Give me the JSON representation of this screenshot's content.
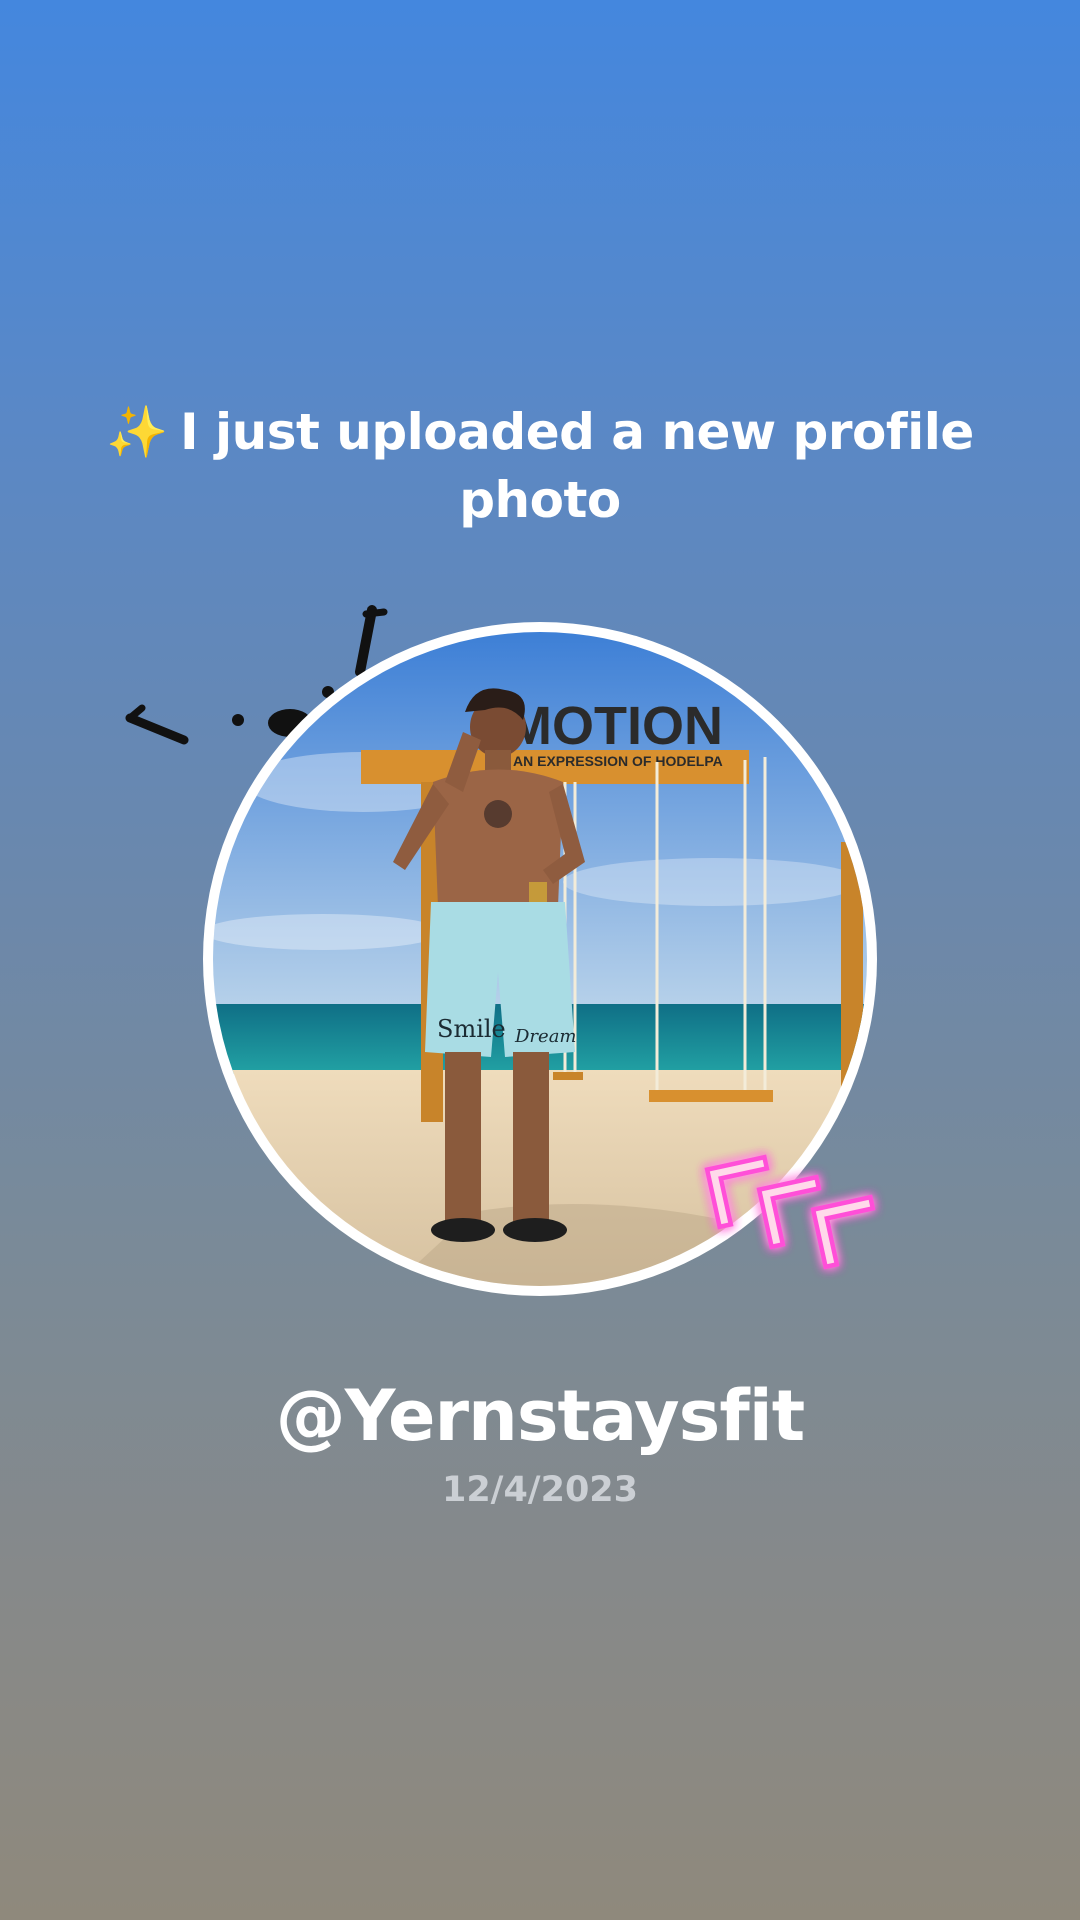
{
  "headline": {
    "sparkle_icon": "✨",
    "text": "I just uploaded a new profile photo"
  },
  "profile": {
    "username": "@Yernstaysfit",
    "date": "12/4/2023"
  },
  "photo": {
    "sign_text": "EMOTION",
    "sign_subtext": "AN EXPRESSION OF HODELPA",
    "shorts_text_1": "Smile",
    "shorts_text_2": "Dream"
  },
  "decorations": {
    "doodle": "face-doodle-icon",
    "neon": "neon-chevrons-icon"
  },
  "colors": {
    "sky_top": "#4487de",
    "bottom": "#8f897c",
    "neon_pink": "#ff4fd8",
    "sign_pink": "#ea3f6e"
  }
}
